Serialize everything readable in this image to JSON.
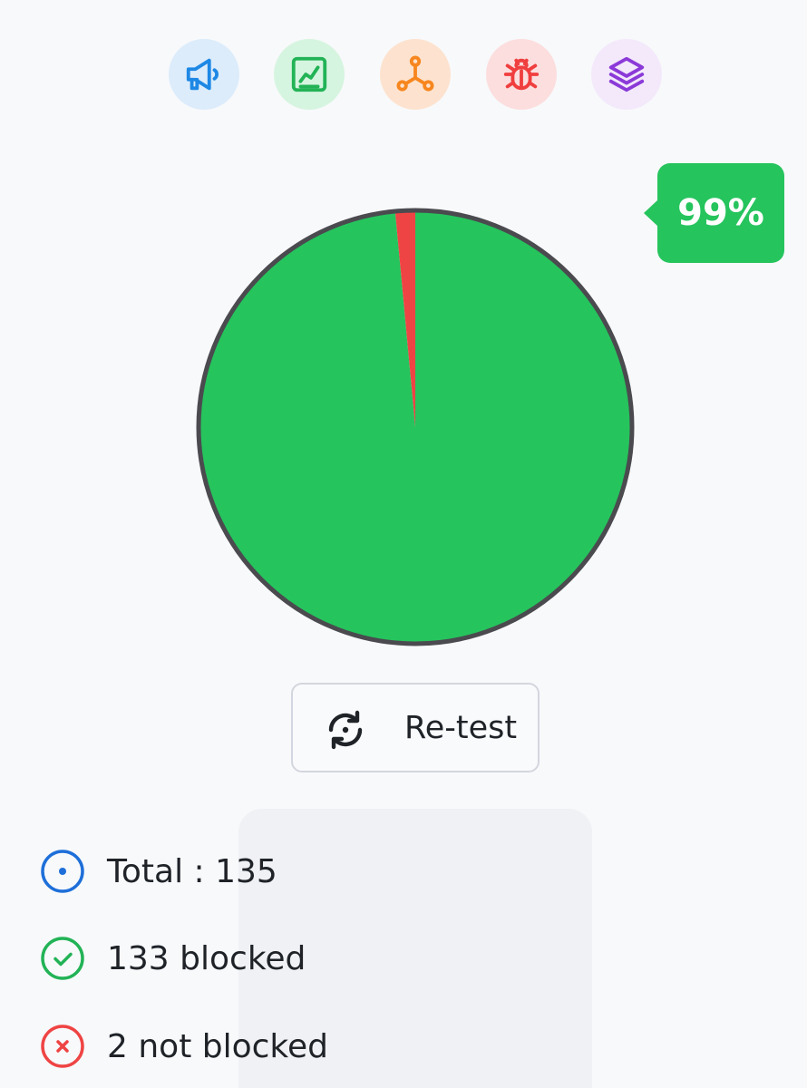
{
  "categories": [
    {
      "icon": "megaphone-icon",
      "color": "#1e88e5",
      "bg": "#dcecfb"
    },
    {
      "icon": "chart-icon",
      "color": "#22b356",
      "bg": "#d6f5e0"
    },
    {
      "icon": "network-icon",
      "color": "#f7861e",
      "bg": "#fde3cf"
    },
    {
      "icon": "bug-icon",
      "color": "#f03e3e",
      "bg": "#fcdede"
    },
    {
      "icon": "layers-icon",
      "color": "#8b3ad8",
      "bg": "#f3e9fb"
    }
  ],
  "chart_data": {
    "type": "pie",
    "slices": [
      {
        "label": "blocked",
        "value": 133,
        "color": "#26c45d"
      },
      {
        "label": "not blocked",
        "value": 2,
        "color": "#ef4444"
      }
    ]
  },
  "badge": {
    "label": "99%"
  },
  "retest": {
    "label": "Re-test",
    "icon": "refresh-icon"
  },
  "stats": {
    "total": "Total : 135",
    "blocked": "133 blocked",
    "not_blocked": "2 not blocked",
    "total_color": "#1e6fd9",
    "blocked_color": "#22b356",
    "not_blocked_color": "#ef4444"
  }
}
